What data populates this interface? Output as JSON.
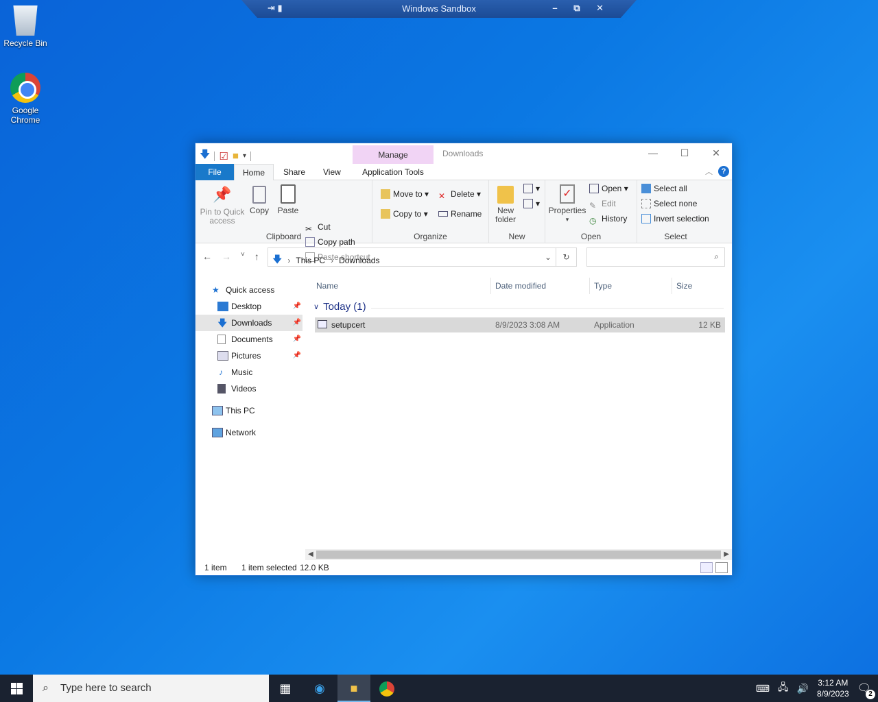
{
  "sandbox": {
    "title": "Windows Sandbox",
    "left_icons": "⇥ ▮",
    "right_icons": "– ⧉ ✕"
  },
  "desktop": {
    "icons": [
      {
        "label": "Recycle Bin"
      },
      {
        "label": "Google Chrome"
      }
    ]
  },
  "explorer": {
    "title": "Downloads",
    "manage_tab": "Manage",
    "tabs": {
      "file": "File",
      "home": "Home",
      "share": "Share",
      "view": "View",
      "app_tools": "Application Tools"
    },
    "ribbon": {
      "clipboard": {
        "label": "Clipboard",
        "pin": "Pin to Quick access",
        "copy": "Copy",
        "paste": "Paste",
        "cut": "Cut",
        "copy_path": "Copy path",
        "paste_shortcut": "Paste shortcut"
      },
      "organize": {
        "label": "Organize",
        "move_to": "Move to",
        "copy_to": "Copy to",
        "delete": "Delete",
        "rename": "Rename"
      },
      "new": {
        "label": "New",
        "new_folder": "New folder"
      },
      "open": {
        "label": "Open",
        "properties": "Properties",
        "open": "Open",
        "edit": "Edit",
        "history": "History"
      },
      "select": {
        "label": "Select",
        "select_all": "Select all",
        "select_none": "Select none",
        "invert": "Invert selection"
      }
    },
    "address": {
      "crumbs": [
        "This PC",
        "Downloads"
      ]
    },
    "search": {
      "placeholder": ""
    },
    "nav": {
      "quick_access": "Quick access",
      "desktop": "Desktop",
      "downloads": "Downloads",
      "documents": "Documents",
      "pictures": "Pictures",
      "music": "Music",
      "videos": "Videos",
      "this_pc": "This PC",
      "network": "Network"
    },
    "columns": {
      "name": "Name",
      "date": "Date modified",
      "type": "Type",
      "size": "Size"
    },
    "group": "Today (1)",
    "files": [
      {
        "name": "setupcert",
        "date": "8/9/2023 3:08 AM",
        "type": "Application",
        "size": "12 KB"
      }
    ],
    "status": {
      "count": "1 item",
      "selected": "1 item selected",
      "size": "12.0 KB"
    }
  },
  "taskbar": {
    "search_placeholder": "Type here to search",
    "time": "3:12 AM",
    "date": "8/9/2023",
    "notifications": "2"
  },
  "colors": {
    "accent": "#1979ca",
    "manage_tab": "#f1d4f5",
    "taskbar": "#1a2230"
  }
}
